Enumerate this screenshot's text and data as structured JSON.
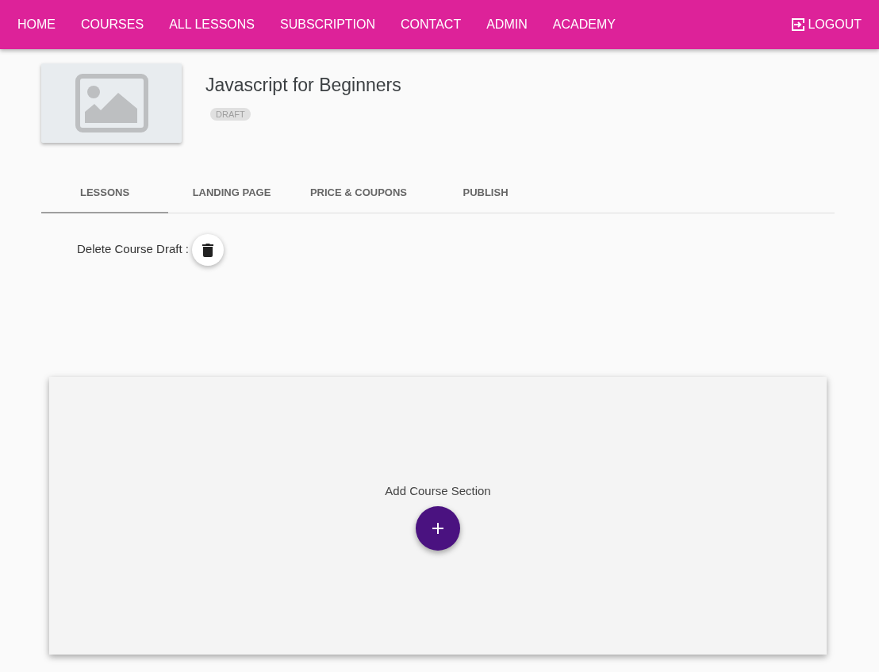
{
  "navbar": {
    "items": [
      {
        "label": "HOME"
      },
      {
        "label": "COURSES"
      },
      {
        "label": "ALL LESSONS"
      },
      {
        "label": "SUBSCRIPTION"
      },
      {
        "label": "CONTACT"
      },
      {
        "label": "ADMIN"
      },
      {
        "label": "ACADEMY"
      }
    ],
    "logout": "LOGOUT"
  },
  "course": {
    "title": "Javascript for Beginners",
    "status": "DRAFT"
  },
  "tabs": [
    {
      "label": "LESSONS",
      "selected": true
    },
    {
      "label": "LANDING PAGE",
      "selected": false
    },
    {
      "label": "PRICE & COUPONS",
      "selected": false
    },
    {
      "label": "PUBLISH",
      "selected": false
    }
  ],
  "delete_label": "Delete Course Draft :",
  "section_card": {
    "label": "Add Course Section"
  }
}
